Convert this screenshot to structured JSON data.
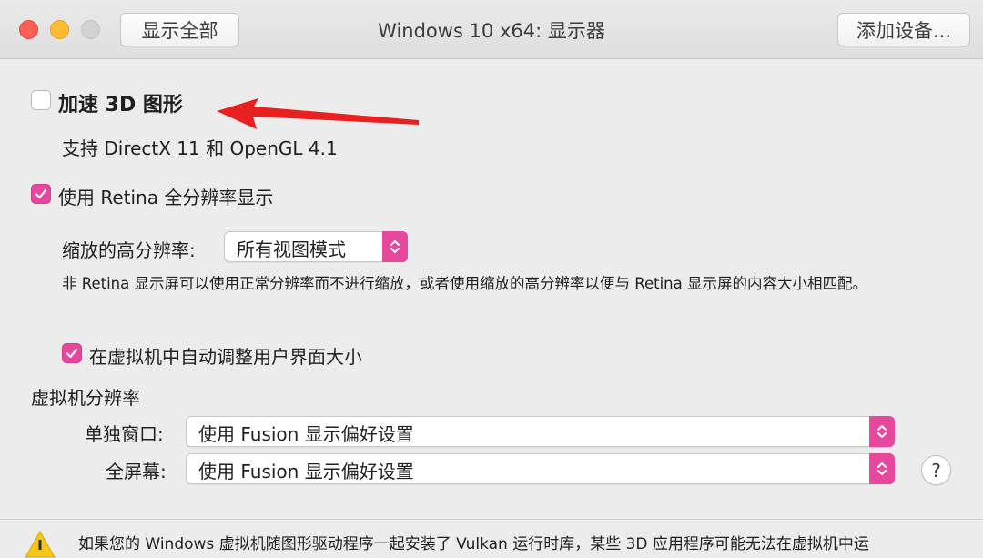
{
  "window": {
    "title": "Windows 10 x64: 显示器",
    "show_all_label": "显示全部",
    "add_device_label": "添加设备..."
  },
  "accelerate_3d": {
    "label": "加速 3D 图形",
    "checked": false,
    "support_note": "支持 DirectX 11 和 OpenGL 4.1"
  },
  "retina": {
    "label": "使用 Retina 全分辨率显示",
    "checked": true,
    "scaled_label": "缩放的高分辨率:",
    "scaled_value": "所有视图模式",
    "description": "非 Retina 显示屏可以使用正常分辨率而不进行缩放，或者使用缩放的高分辨率以便与 Retina 显示屏的内容大小相匹配。"
  },
  "auto_resize": {
    "label": "在虚拟机中自动调整用户界面大小",
    "checked": true
  },
  "vm_resolution": {
    "heading": "虚拟机分辨率",
    "single_window_label": "单独窗口:",
    "single_window_value": "使用 Fusion 显示偏好设置",
    "fullscreen_label": "全屏幕:",
    "fullscreen_value": "使用 Fusion 显示偏好设置"
  },
  "help_label": "?",
  "footer": {
    "warning_text": "如果您的 Windows 虚拟机随图形驱动程序一起安装了 Vulkan 运行时库，某些 3D 应用程序可能无法在虚拟机中运"
  },
  "colors": {
    "accent": "#e7479c",
    "annotation_arrow": "#e82020"
  }
}
